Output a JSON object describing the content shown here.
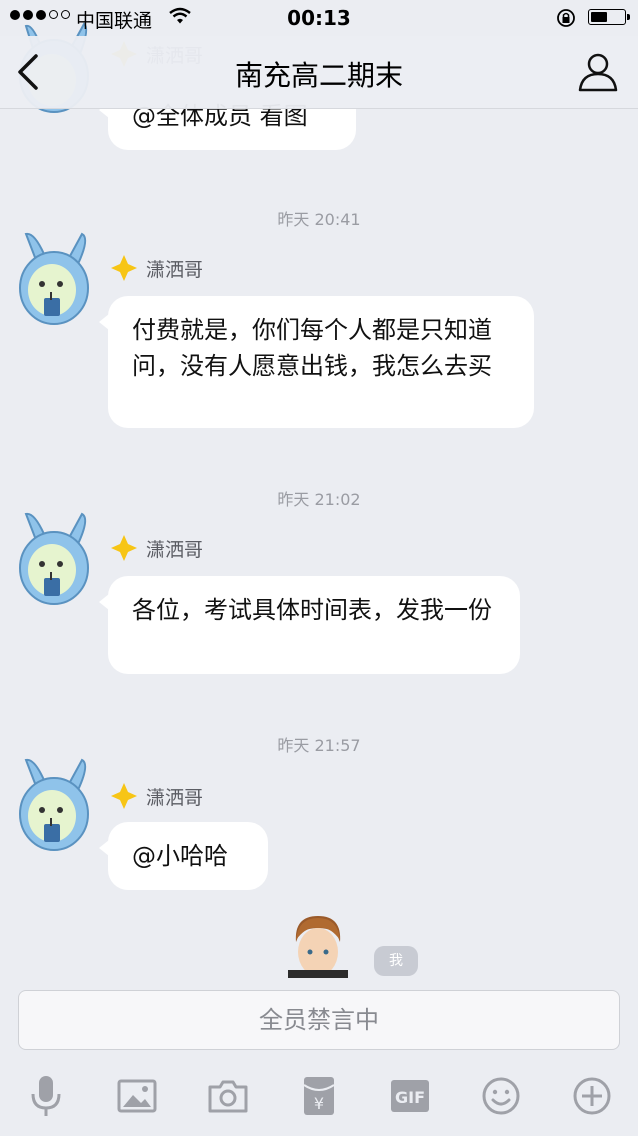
{
  "status_bar": {
    "carrier": "中国联通",
    "time": "00:13"
  },
  "nav": {
    "title": "南充高二期末"
  },
  "messages": [
    {
      "sender": "",
      "text": "@全体成员 看图"
    },
    {
      "timestamp": "昨天 20:41",
      "sender": "潇洒哥",
      "text": "付费就是，你们每个人都是只知道问，没有人愿意出钱，我怎么去买"
    },
    {
      "timestamp": "昨天 21:02",
      "sender": "潇洒哥",
      "text": "各位，考试具体时间表，发我一份"
    },
    {
      "timestamp": "昨天 21:57",
      "sender": "潇洒哥",
      "text": "@小哈哈"
    }
  ],
  "me_badge": "我",
  "input": {
    "muted_text": "全员禁言中"
  },
  "toolbar": {
    "icons": [
      "microphone-icon",
      "image-icon",
      "camera-icon",
      "red-packet-icon",
      "gif-icon",
      "emoji-icon",
      "plus-icon"
    ],
    "gif_label": "GIF",
    "yen_label": "¥"
  },
  "colors": {
    "background": "#ebedf2",
    "bubble": "#ffffff",
    "timestamp": "#9a9ca3",
    "toolbar_icon": "#9fa1a8",
    "avatar_blue": "#8fc3ea",
    "star_yellow": "#f7c515"
  }
}
